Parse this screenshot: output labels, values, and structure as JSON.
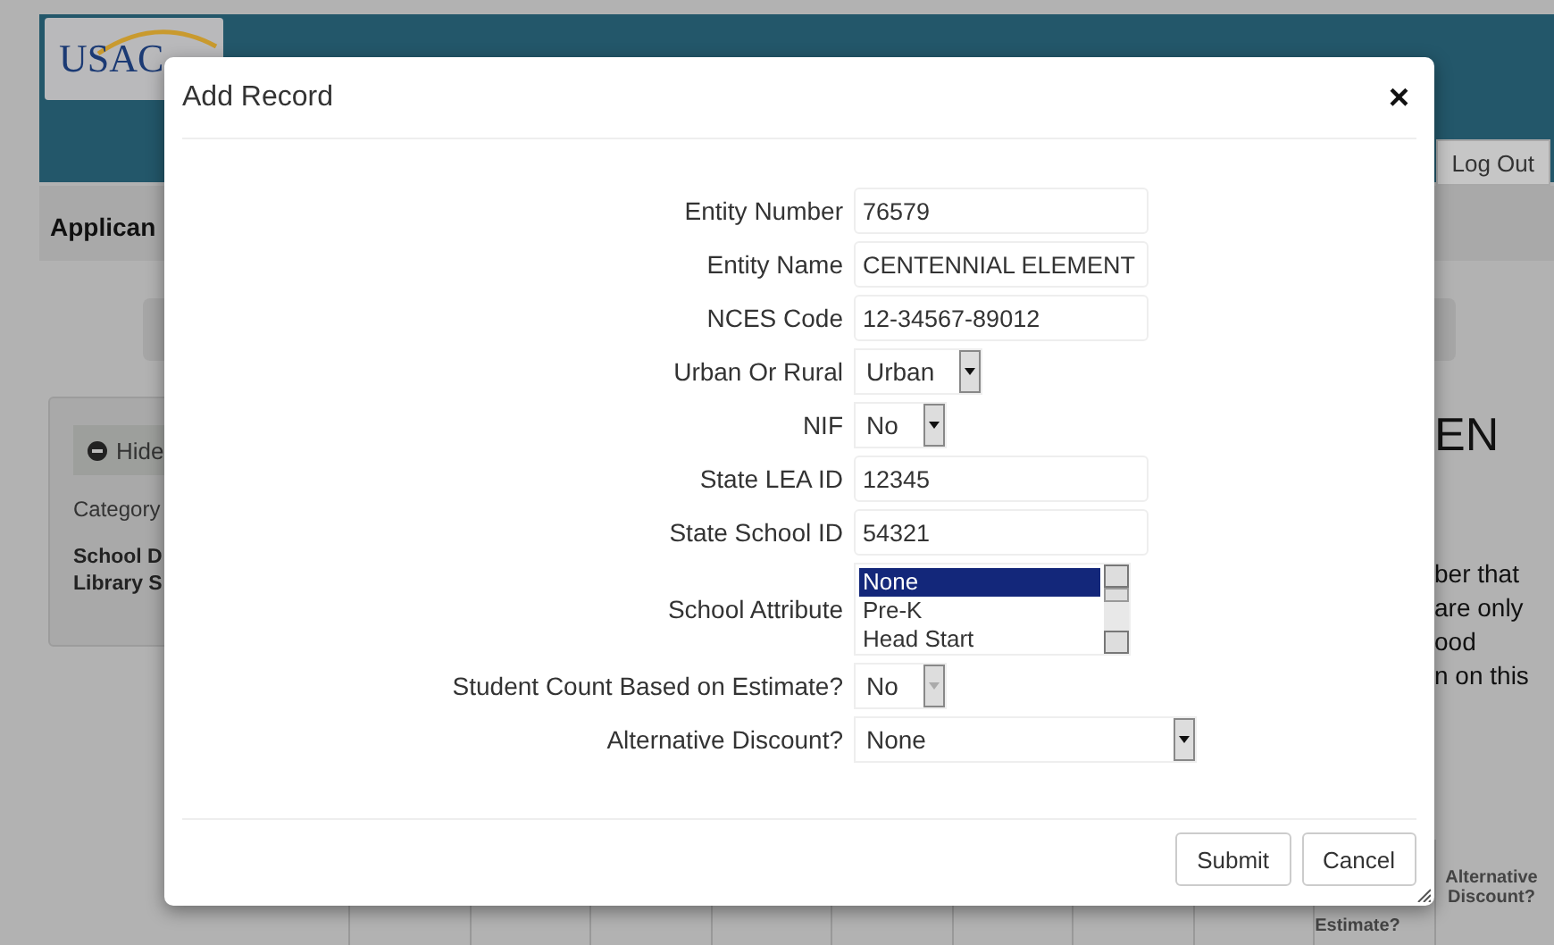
{
  "page": {
    "logo_text": "USAC",
    "logout": "Log Out",
    "section_heading": "Applican",
    "hide_button": "Hide",
    "category_label": "Category",
    "category_lines": [
      "School D",
      "Library S"
    ],
    "large_heading": "EN",
    "paragraph_lines": [
      "ber that",
      "are only",
      "ood",
      "n on this"
    ],
    "table_headers": [
      "Alternative Discount?",
      "Estimate?"
    ]
  },
  "dialog": {
    "title": "Add Record",
    "close": "×",
    "fields": [
      {
        "kind": "text",
        "label": "Entity Number",
        "value": "76579"
      },
      {
        "kind": "text",
        "label": "Entity Name",
        "value": "CENTENNIAL ELEMENT"
      },
      {
        "kind": "text",
        "label": "NCES Code",
        "value": "12-34567-89012"
      },
      {
        "kind": "select",
        "label": "Urban Or Rural",
        "value": "Urban"
      },
      {
        "kind": "select",
        "label": "NIF",
        "value": "No"
      },
      {
        "kind": "text",
        "label": "State LEA ID",
        "value": "12345"
      },
      {
        "kind": "text",
        "label": "State School ID",
        "value": "54321"
      },
      {
        "kind": "listbox",
        "label": "School Attribute",
        "options": [
          {
            "label": "None",
            "selected": true
          },
          {
            "label": "Pre-K",
            "selected": false
          },
          {
            "label": "Head Start",
            "selected": false
          }
        ]
      },
      {
        "kind": "select",
        "disabled": true,
        "label": "Student Count Based on Estimate?",
        "value": "No"
      },
      {
        "kind": "wide_select",
        "label": "Alternative Discount?",
        "value": "None"
      }
    ],
    "buttons": [
      "Submit",
      "Cancel"
    ]
  }
}
